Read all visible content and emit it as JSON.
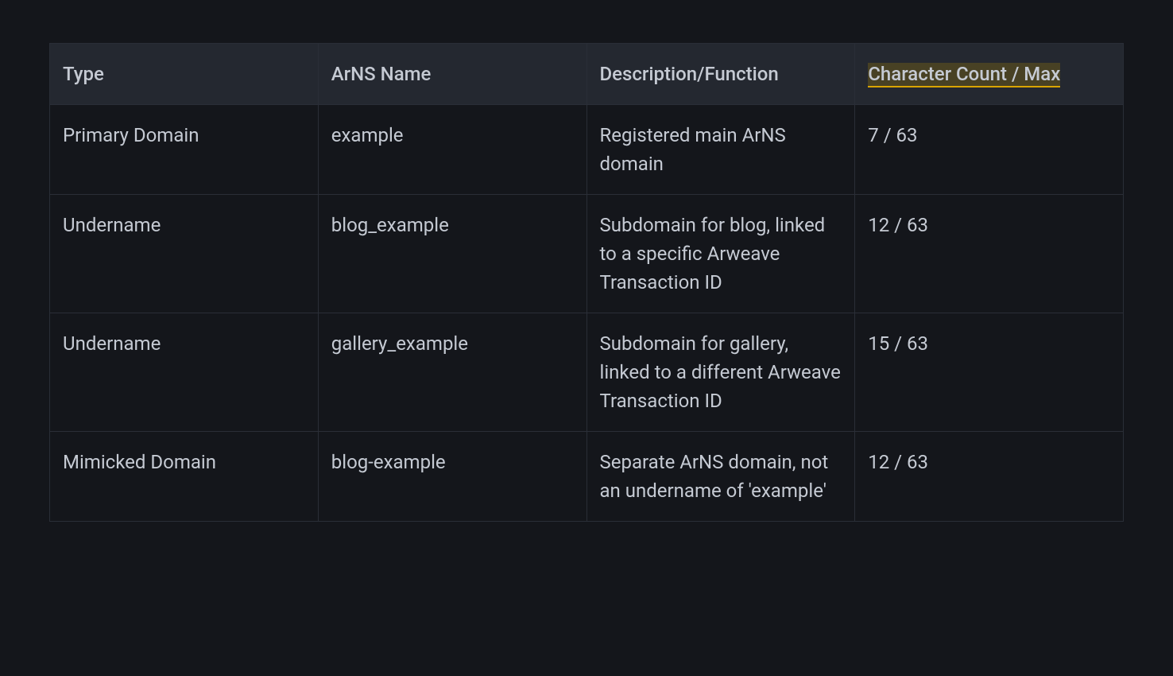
{
  "table": {
    "headers": {
      "type": "Type",
      "name": "ArNS Name",
      "desc": "Description/Function",
      "count": "Character Count / Max"
    },
    "rows": [
      {
        "type": "Primary Domain",
        "name": "example",
        "desc": "Registered main ArNS domain",
        "count": "7 / 63"
      },
      {
        "type": "Undername",
        "name": "blog_example",
        "desc": "Subdomain for blog, linked to a specific Arweave Transaction ID",
        "count": "12 / 63"
      },
      {
        "type": "Undername",
        "name": "gallery_example",
        "desc": "Subdomain for gallery, linked to a different Arweave Transaction ID",
        "count": "15 / 63"
      },
      {
        "type": "Mimicked Domain",
        "name": "blog-example",
        "desc": "Separate ArNS domain, not an undername of 'example'",
        "count": "12 / 63"
      }
    ]
  }
}
